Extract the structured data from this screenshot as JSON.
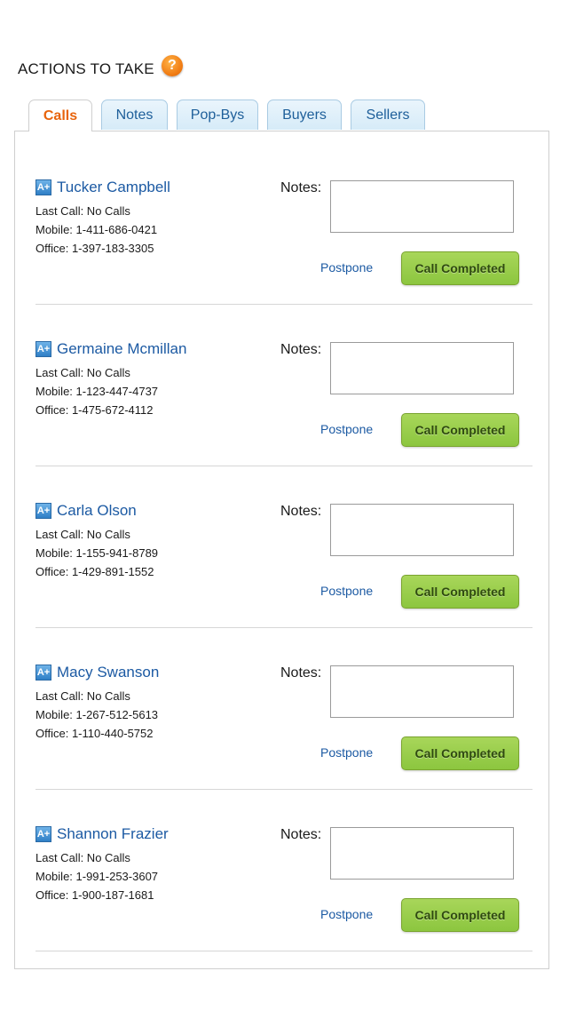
{
  "header": {
    "title": "ACTIONS TO TAKE",
    "help_icon": "?"
  },
  "tabs": [
    {
      "label": "Calls",
      "active": true
    },
    {
      "label": "Notes",
      "active": false
    },
    {
      "label": "Pop-Bys",
      "active": false
    },
    {
      "label": "Buyers",
      "active": false
    },
    {
      "label": "Sellers",
      "active": false
    }
  ],
  "contacts": [
    {
      "badge": "A+",
      "name": "Tucker Campbell",
      "last_call": "Last Call: No Calls",
      "mobile": "Mobile: 1-411-686-0421",
      "office": "Office: 1-397-183-3305",
      "notes_label": "Notes:",
      "notes_value": "",
      "postpone": "Postpone",
      "complete": "Call Completed"
    },
    {
      "badge": "A+",
      "name": "Germaine Mcmillan",
      "last_call": "Last Call: No Calls",
      "mobile": "Mobile: 1-123-447-4737",
      "office": "Office: 1-475-672-4112",
      "notes_label": "Notes:",
      "notes_value": "",
      "postpone": "Postpone",
      "complete": "Call Completed"
    },
    {
      "badge": "A+",
      "name": "Carla Olson",
      "last_call": "Last Call: No Calls",
      "mobile": "Mobile: 1-155-941-8789",
      "office": "Office: 1-429-891-1552",
      "notes_label": "Notes:",
      "notes_value": "",
      "postpone": "Postpone",
      "complete": "Call Completed"
    },
    {
      "badge": "A+",
      "name": "Macy Swanson",
      "last_call": "Last Call: No Calls",
      "mobile": "Mobile: 1-267-512-5613",
      "office": "Office: 1-110-440-5752",
      "notes_label": "Notes:",
      "notes_value": "",
      "postpone": "Postpone",
      "complete": "Call Completed"
    },
    {
      "badge": "A+",
      "name": "Shannon Frazier",
      "last_call": "Last Call: No Calls",
      "mobile": "Mobile: 1-991-253-3607",
      "office": "Office: 1-900-187-1681",
      "notes_label": "Notes:",
      "notes_value": "",
      "postpone": "Postpone",
      "complete": "Call Completed"
    }
  ],
  "colors": {
    "accent": "#e8640c",
    "link": "#1c5aa3",
    "button": "#8cc63f"
  }
}
